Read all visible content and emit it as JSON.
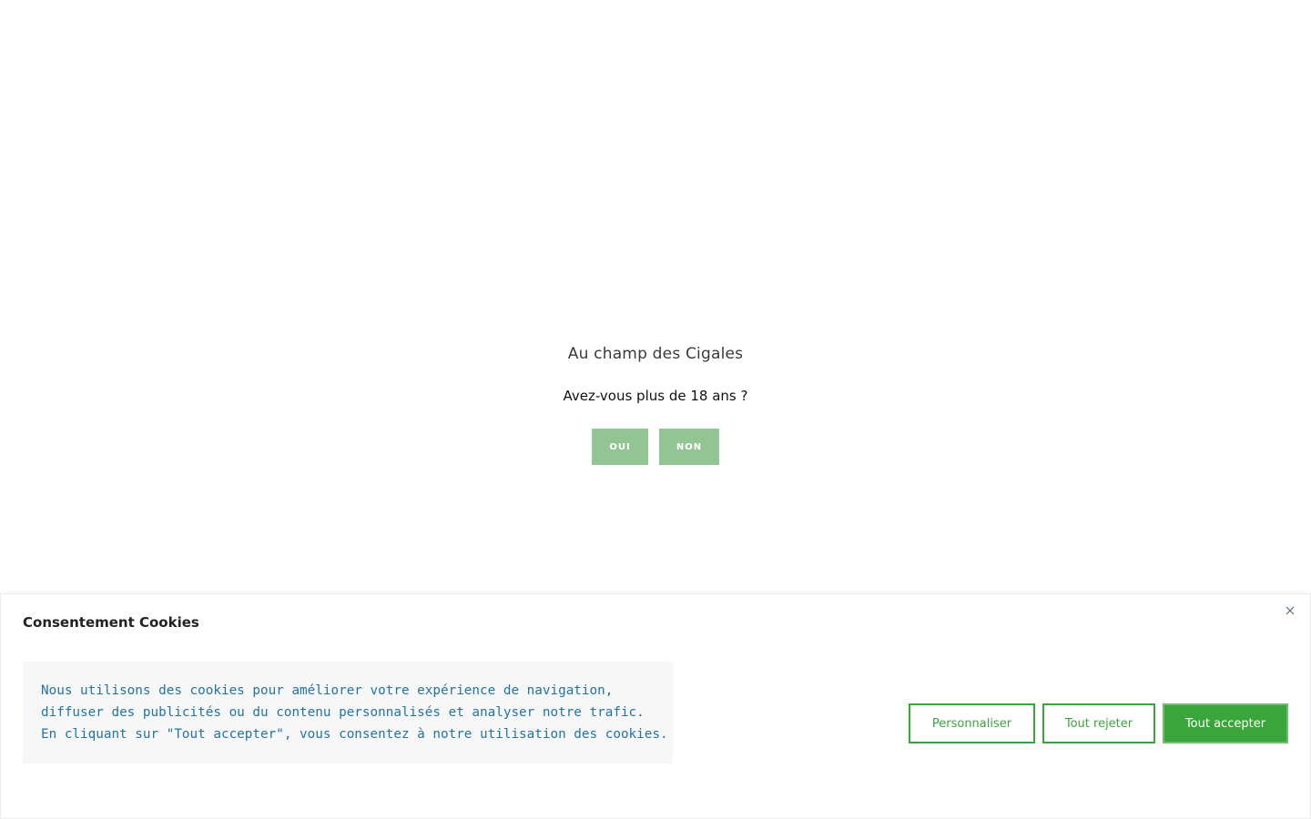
{
  "age_gate": {
    "title": "Au champ des Cigales",
    "question": "Avez-vous plus de 18 ans ?",
    "yes_label": "OUI",
    "no_label": "NON",
    "button_color": "#93c594"
  },
  "cookie_banner": {
    "title": "Consentement Cookies",
    "close_icon": "close-icon",
    "message_lines": [
      "Nous utilisons des cookies pour améliorer votre expérience de navigation,",
      "diffuser des publicités ou du contenu personnalisés et analyser notre trafic.",
      "En cliquant sur \"Tout accepter\", vous consentez à notre utilisation des cookies."
    ],
    "customize_label": "Personnaliser",
    "reject_label": "Tout rejeter",
    "accept_label": "Tout accepter",
    "accent_color": "#3aa53a",
    "message_text_color": "#2474a3"
  }
}
